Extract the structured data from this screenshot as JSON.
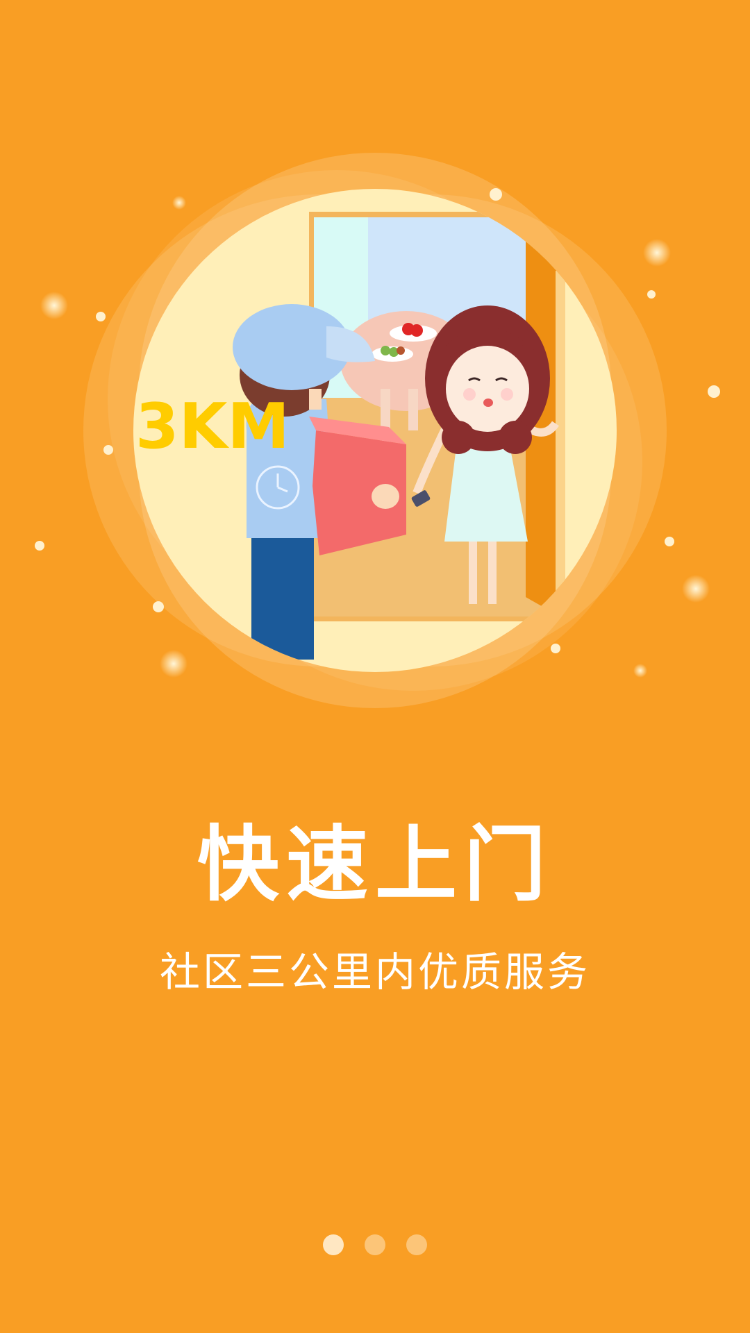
{
  "illustration": {
    "distance_label": "3KM",
    "icon": "delivery-illustration"
  },
  "onboarding": {
    "title": "快速上门",
    "subtitle": "社区三公里内优质服务"
  },
  "pager": {
    "page_count": 3,
    "current_page": 1
  },
  "colors": {
    "background": "#F99E24",
    "accent_text": "#FFCC00",
    "text": "#FFFFFF"
  }
}
